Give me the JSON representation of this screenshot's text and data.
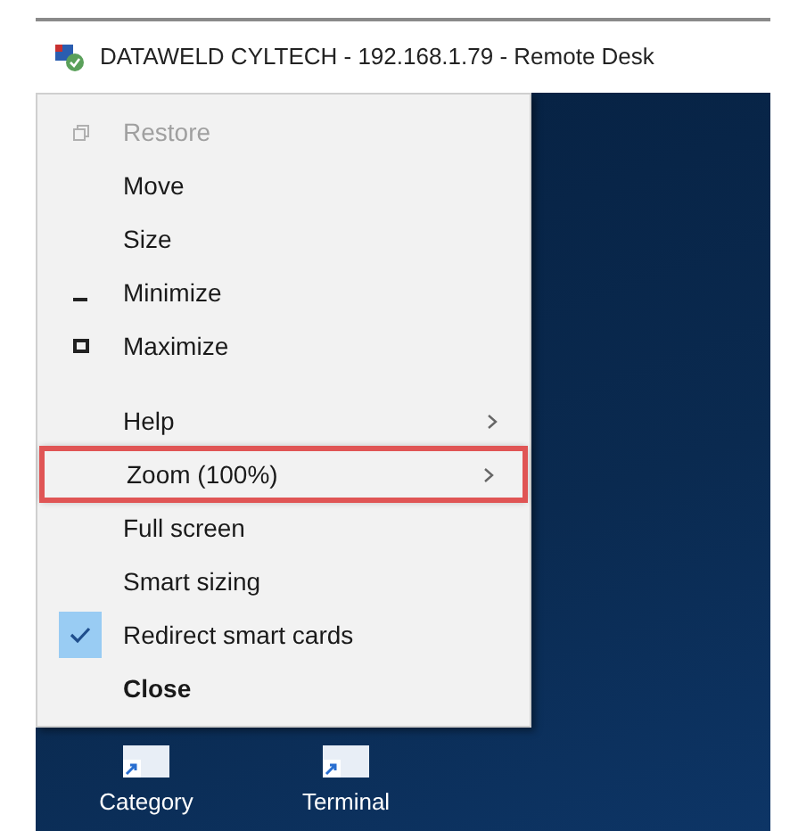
{
  "window": {
    "title": "DATAWELD CYLTECH - 192.168.1.79 - Remote Desk"
  },
  "menu": [
    {
      "kind": "restore",
      "label": "Restore",
      "disabled": true,
      "checked": false,
      "submenu": false,
      "default": false,
      "highlighted": false
    },
    {
      "kind": "plain",
      "label": "Move",
      "disabled": false,
      "checked": false,
      "submenu": false,
      "default": false,
      "highlighted": false
    },
    {
      "kind": "plain",
      "label": "Size",
      "disabled": false,
      "checked": false,
      "submenu": false,
      "default": false,
      "highlighted": false
    },
    {
      "kind": "minimize",
      "label": "Minimize",
      "disabled": false,
      "checked": false,
      "submenu": false,
      "default": false,
      "highlighted": false
    },
    {
      "kind": "maximize",
      "label": "Maximize",
      "disabled": false,
      "checked": false,
      "submenu": false,
      "default": false,
      "highlighted": false
    },
    {
      "kind": "separator"
    },
    {
      "kind": "plain",
      "label": "Help",
      "disabled": false,
      "checked": false,
      "submenu": true,
      "default": false,
      "highlighted": false
    },
    {
      "kind": "plain",
      "label": "Zoom (100%)",
      "disabled": false,
      "checked": false,
      "submenu": true,
      "default": false,
      "highlighted": true
    },
    {
      "kind": "plain",
      "label": "Full screen",
      "disabled": false,
      "checked": false,
      "submenu": false,
      "default": false,
      "highlighted": false
    },
    {
      "kind": "plain",
      "label": "Smart sizing",
      "disabled": false,
      "checked": false,
      "submenu": false,
      "default": false,
      "highlighted": false
    },
    {
      "kind": "plain",
      "label": "Redirect smart cards",
      "disabled": false,
      "checked": true,
      "submenu": false,
      "default": false,
      "highlighted": false
    },
    {
      "kind": "plain",
      "label": "Close",
      "disabled": false,
      "checked": false,
      "submenu": false,
      "default": true,
      "highlighted": false
    }
  ],
  "desktop_icons": [
    {
      "label": "Category"
    },
    {
      "label": "Terminal"
    }
  ]
}
